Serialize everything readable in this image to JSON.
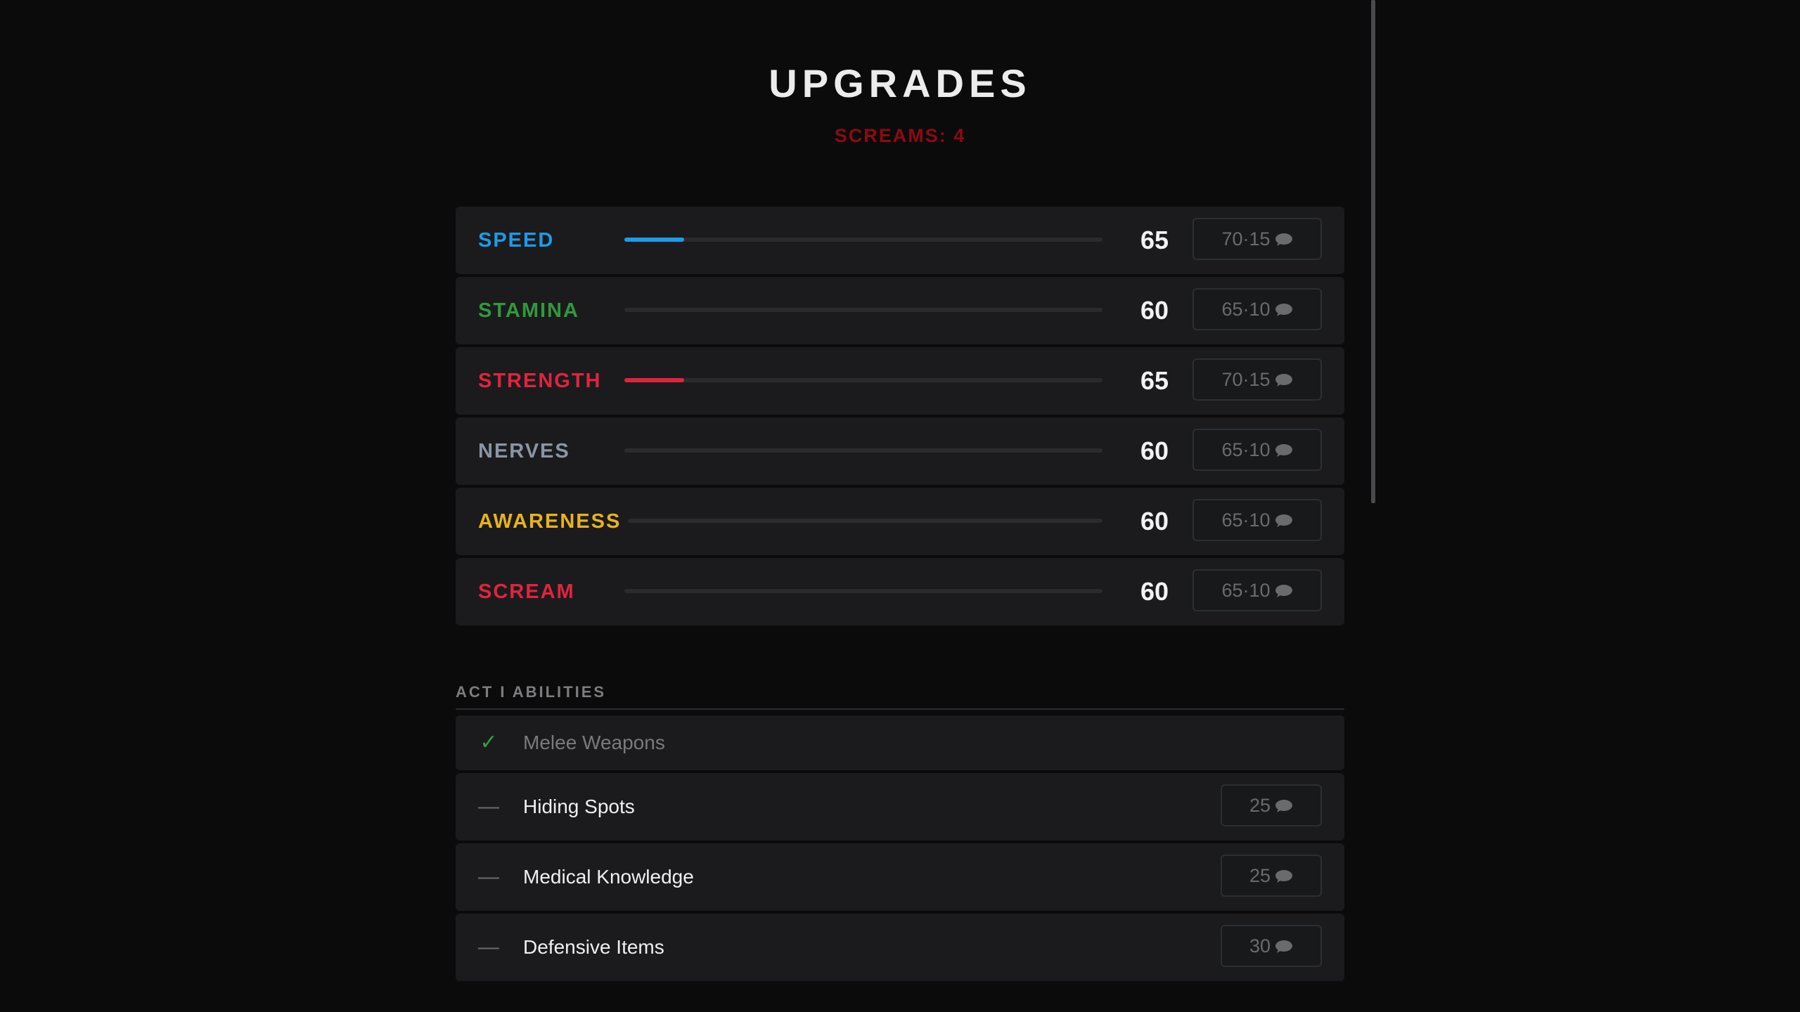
{
  "header": {
    "title": "UPGRADES",
    "screams_label": "SCREAMS: 4"
  },
  "stats": [
    {
      "name": "SPEED",
      "color": "#1e9be6",
      "value": "65",
      "next": "70",
      "cost": "15",
      "progress": 0.125
    },
    {
      "name": "STAMINA",
      "color": "#2f9a3c",
      "value": "60",
      "next": "65",
      "cost": "10",
      "progress": 0
    },
    {
      "name": "STRENGTH",
      "color": "#e0243f",
      "value": "65",
      "next": "70",
      "cost": "15",
      "progress": 0.125
    },
    {
      "name": "NERVES",
      "color": "#8a96a6",
      "value": "60",
      "next": "65",
      "cost": "10",
      "progress": 0
    },
    {
      "name": "AWARENESS",
      "color": "#e8b31b",
      "value": "60",
      "next": "65",
      "cost": "10",
      "progress": 0
    },
    {
      "name": "SCREAM",
      "color": "#e0243f",
      "value": "60",
      "next": "65",
      "cost": "10",
      "progress": 0
    }
  ],
  "abilities_section": {
    "title": "ACT I ABILITIES",
    "items": [
      {
        "label": "Melee Weapons",
        "owned": true,
        "mark": "✓",
        "cost": ""
      },
      {
        "label": "Hiding Spots",
        "owned": false,
        "mark": "—",
        "cost": "25"
      },
      {
        "label": "Medical Knowledge",
        "owned": false,
        "mark": "—",
        "cost": "25"
      },
      {
        "label": "Defensive Items",
        "owned": false,
        "mark": "—",
        "cost": "30"
      }
    ]
  },
  "icons": {
    "currency": "speech-bubble-icon",
    "owned": "check-icon"
  }
}
